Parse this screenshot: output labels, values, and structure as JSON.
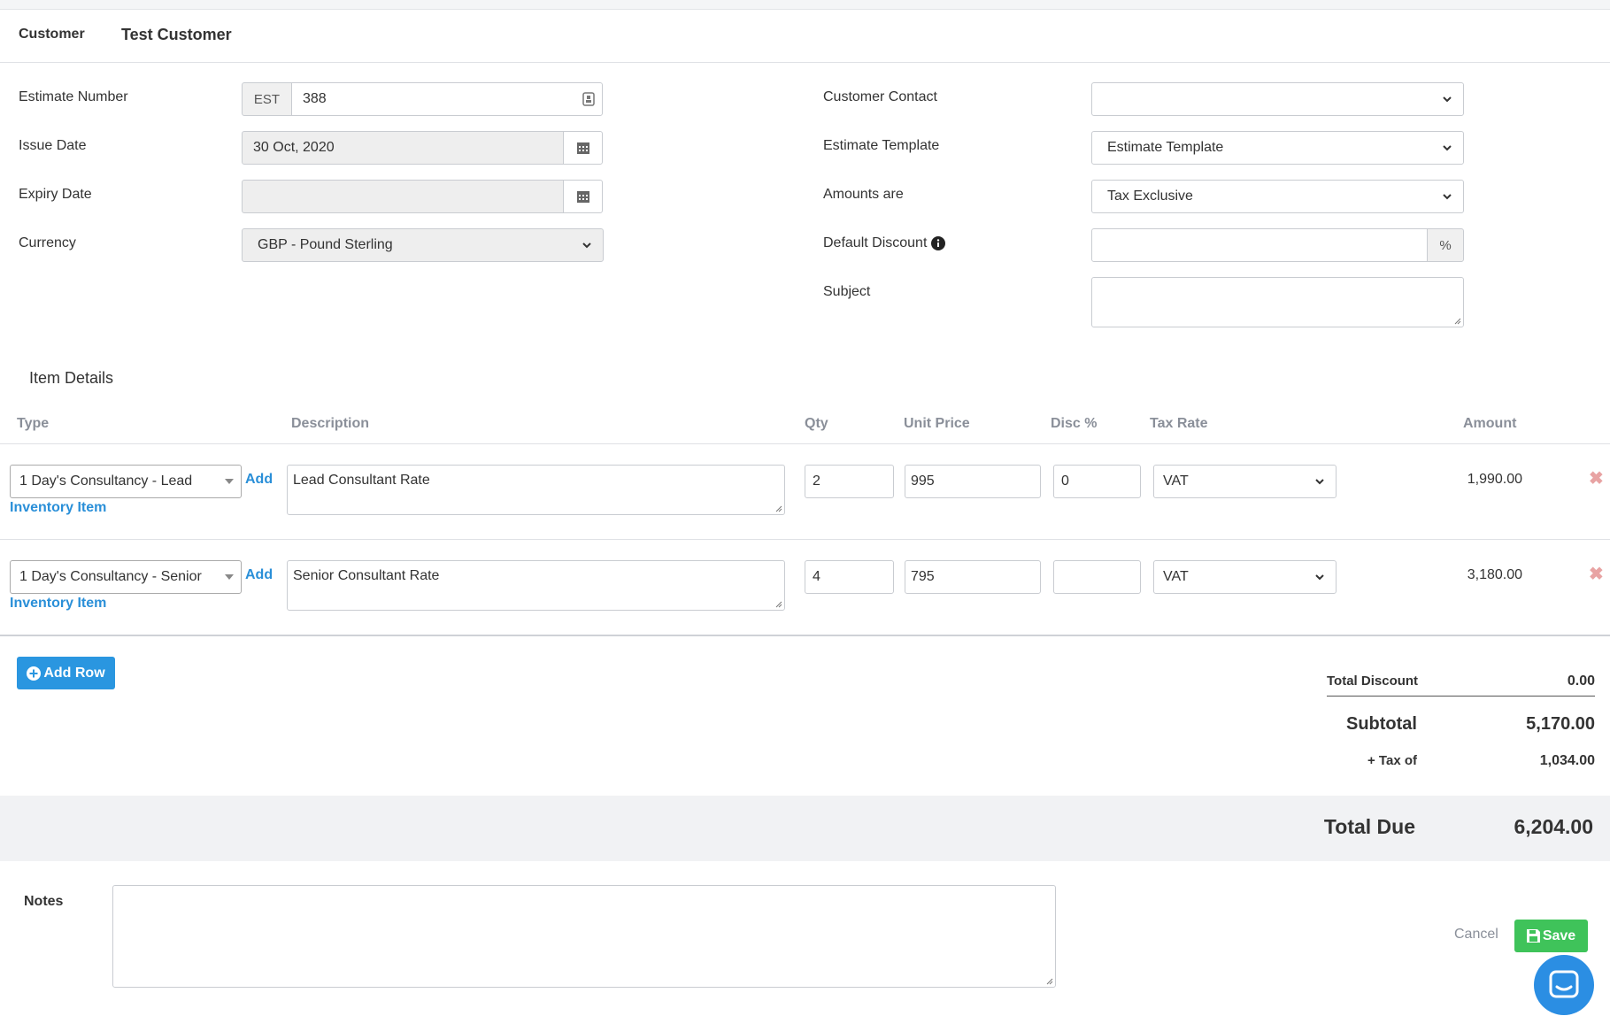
{
  "customer": {
    "label": "Customer",
    "name": "Test Customer"
  },
  "left_form": {
    "estimate_number": {
      "label": "Estimate Number",
      "prefix": "EST",
      "value": "388"
    },
    "issue_date": {
      "label": "Issue Date",
      "value": "30 Oct, 2020"
    },
    "expiry_date": {
      "label": "Expiry Date",
      "value": ""
    },
    "currency": {
      "label": "Currency",
      "value": "GBP - Pound Sterling"
    }
  },
  "right_form": {
    "customer_contact": {
      "label": "Customer Contact",
      "value": ""
    },
    "estimate_template": {
      "label": "Estimate Template",
      "value": "Estimate Template"
    },
    "amounts_are": {
      "label": "Amounts are",
      "value": "Tax Exclusive"
    },
    "default_discount": {
      "label": "Default Discount",
      "value": "",
      "suffix": "%"
    },
    "subject": {
      "label": "Subject",
      "value": ""
    }
  },
  "items": {
    "title": "Item Details",
    "columns": {
      "type": "Type",
      "description": "Description",
      "qty": "Qty",
      "unit_price": "Unit Price",
      "disc": "Disc %",
      "tax_rate": "Tax Rate",
      "amount": "Amount"
    },
    "add_inventory": {
      "add": "Add",
      "inventory": "Inventory Item"
    },
    "rows": [
      {
        "type": "1 Day's Consultancy - Lead",
        "description": "Lead Consultant Rate",
        "qty": "2",
        "unit_price": "995",
        "disc": "0",
        "tax_rate": "VAT",
        "amount": "1,990.00"
      },
      {
        "type": "1 Day's Consultancy - Senior",
        "description": "Senior Consultant Rate",
        "qty": "4",
        "unit_price": "795",
        "disc": "",
        "tax_rate": "VAT",
        "amount": "3,180.00"
      }
    ],
    "add_row": "Add Row"
  },
  "totals": {
    "total_discount": {
      "label": "Total Discount",
      "value": "0.00"
    },
    "subtotal": {
      "label": "Subtotal",
      "value": "5,170.00"
    },
    "tax": {
      "label": "+ Tax of",
      "value": "1,034.00"
    },
    "total_due": {
      "label": "Total Due",
      "value": "6,204.00"
    }
  },
  "notes": {
    "label": "Notes",
    "value": ""
  },
  "actions": {
    "cancel": "Cancel",
    "save": "Save"
  },
  "colors": {
    "accent_blue": "#2a96e0",
    "save_green": "#3fc35a",
    "link_blue": "#2a8fd8",
    "chat_blue": "#2b8ee3"
  }
}
